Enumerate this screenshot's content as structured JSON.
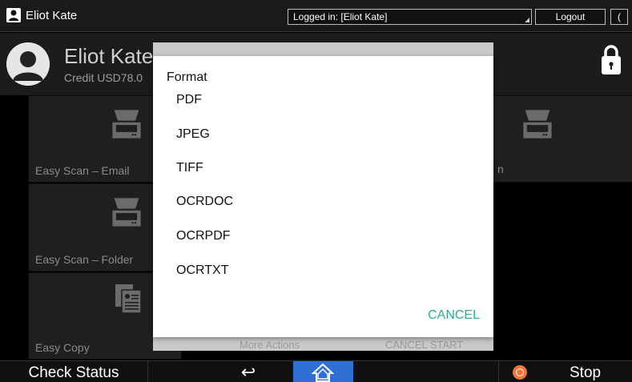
{
  "topbar": {
    "username": "Eliot Kate",
    "login_status": "Logged in: [Eliot Kate]",
    "logout_label": "Logout",
    "extra_label": "("
  },
  "profile": {
    "name": "Eliot Kate",
    "credit": "Credit USD78.0"
  },
  "tiles": [
    {
      "label": "Easy Scan – Email",
      "icon": "scanner-icon"
    },
    {
      "label": "Easy Scan – Folder",
      "icon": "scanner-icon"
    },
    {
      "label": "Easy Copy",
      "icon": "copy-icon"
    },
    {
      "label": "n",
      "icon": "scanner-icon"
    }
  ],
  "background_dialog": {
    "left_fragment": "More Actions",
    "right_fragment": "CANCEL   START"
  },
  "dialog": {
    "title": "Format",
    "options": [
      "PDF",
      "JPEG",
      "TIFF",
      "OCRDOC",
      "OCRPDF",
      "OCRTXT"
    ],
    "cancel_label": "CANCEL",
    "accent_color": "#2cab8e"
  },
  "bottombar": {
    "check_status_label": "Check Status",
    "back_symbol": "↩",
    "stop_label": "Stop",
    "home_color": "#2f6fd4",
    "stop_color": "#f0733b"
  }
}
